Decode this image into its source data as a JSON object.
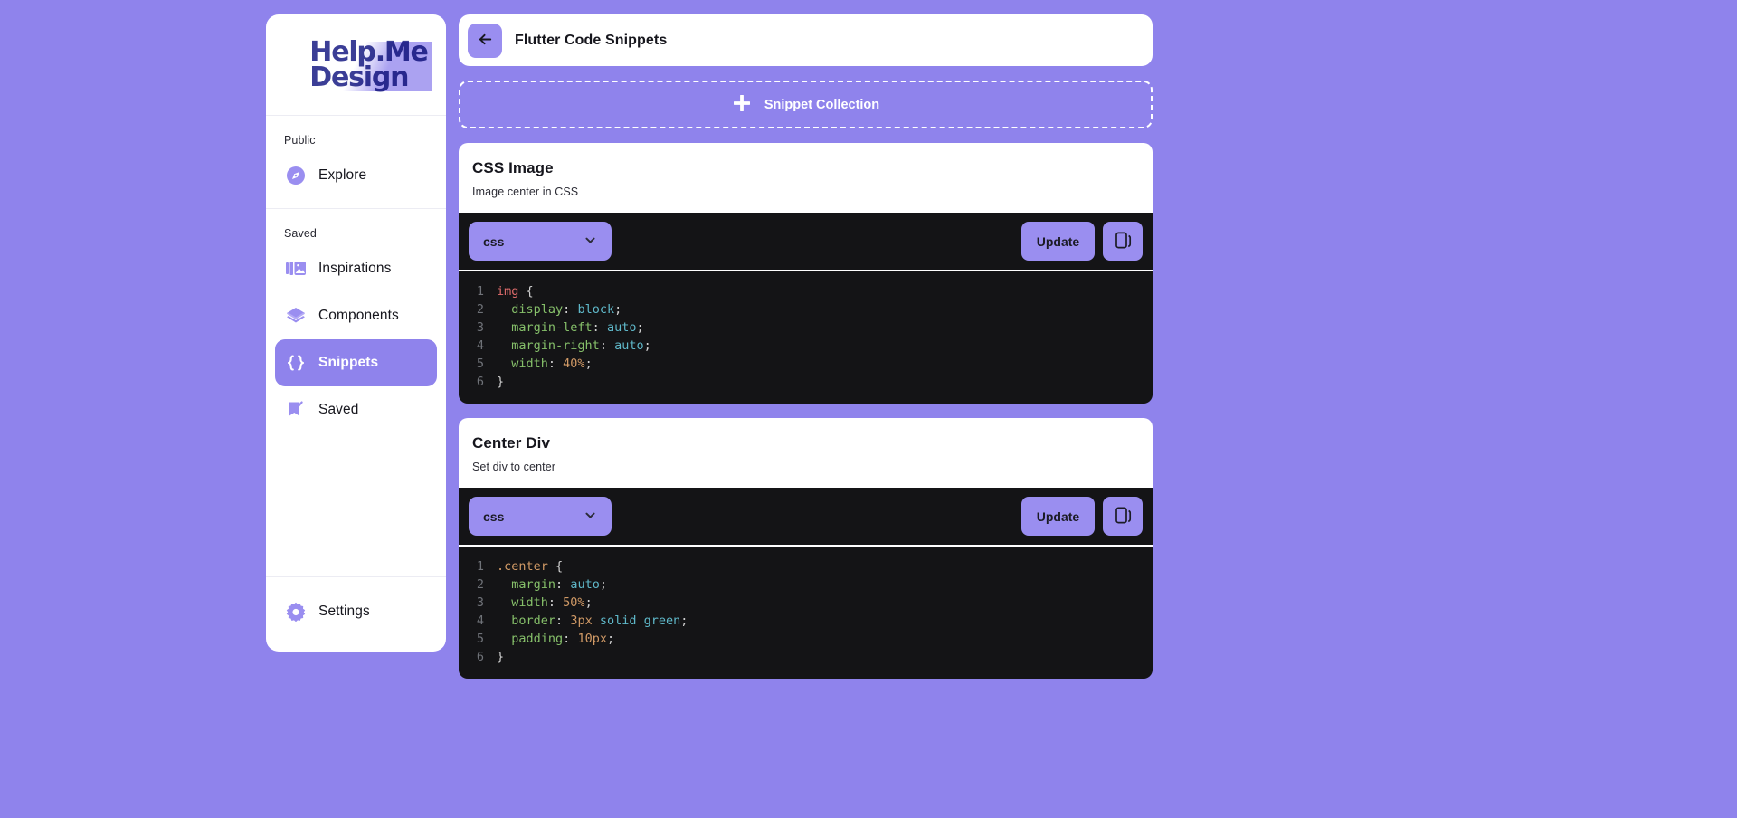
{
  "theme": {
    "background": "#8f83ec",
    "accent": "#9a8ef0",
    "card": "#ffffff",
    "code_bg": "#141416"
  },
  "sidebar": {
    "logo": {
      "line1": "Help.Me",
      "line2": "Design"
    },
    "sections": [
      {
        "label": "Public",
        "items": [
          {
            "label": "Explore",
            "icon": "compass-icon",
            "active": false
          }
        ]
      },
      {
        "label": "Saved",
        "items": [
          {
            "label": "Inspirations",
            "icon": "gallery-icon",
            "active": false
          },
          {
            "label": "Components",
            "icon": "layers-icon",
            "active": false
          },
          {
            "label": "Snippets",
            "icon": "braces-icon",
            "active": true
          },
          {
            "label": "Saved",
            "icon": "bookmark-check-icon",
            "active": false
          }
        ]
      }
    ],
    "settings": {
      "label": "Settings",
      "icon": "gear-icon"
    }
  },
  "topbar": {
    "back_icon": "arrow-left-icon",
    "title": "Flutter Code Snippets"
  },
  "collection_button": {
    "icon": "plus-icon",
    "label": "Snippet Collection"
  },
  "snippets": [
    {
      "title": "CSS Image",
      "description": "Image center in CSS",
      "language": "css",
      "dropdown_icon": "chevron-down-icon",
      "update_label": "Update",
      "copy_icon": "copy-icon",
      "code_lines": [
        {
          "n": "1",
          "tokens": [
            {
              "t": "img",
              "c": "tok-sel"
            },
            {
              "t": " {",
              "c": "tok-punc"
            }
          ]
        },
        {
          "n": "2",
          "tokens": [
            {
              "t": "  ",
              "c": "code-text"
            },
            {
              "t": "display",
              "c": "tok-prop"
            },
            {
              "t": ": ",
              "c": "tok-punc"
            },
            {
              "t": "block",
              "c": "tok-val"
            },
            {
              "t": ";",
              "c": "tok-punc"
            }
          ]
        },
        {
          "n": "3",
          "tokens": [
            {
              "t": "  ",
              "c": "code-text"
            },
            {
              "t": "margin-left",
              "c": "tok-prop"
            },
            {
              "t": ": ",
              "c": "tok-punc"
            },
            {
              "t": "auto",
              "c": "tok-val"
            },
            {
              "t": ";",
              "c": "tok-punc"
            }
          ]
        },
        {
          "n": "4",
          "tokens": [
            {
              "t": "  ",
              "c": "code-text"
            },
            {
              "t": "margin-right",
              "c": "tok-prop"
            },
            {
              "t": ": ",
              "c": "tok-punc"
            },
            {
              "t": "auto",
              "c": "tok-val"
            },
            {
              "t": ";",
              "c": "tok-punc"
            }
          ]
        },
        {
          "n": "5",
          "tokens": [
            {
              "t": "  ",
              "c": "code-text"
            },
            {
              "t": "width",
              "c": "tok-prop"
            },
            {
              "t": ": ",
              "c": "tok-punc"
            },
            {
              "t": "40%",
              "c": "tok-num"
            },
            {
              "t": ";",
              "c": "tok-punc"
            }
          ]
        },
        {
          "n": "6",
          "tokens": [
            {
              "t": "}",
              "c": "tok-punc"
            }
          ]
        }
      ]
    },
    {
      "title": "Center Div",
      "description": "Set div to center",
      "language": "css",
      "dropdown_icon": "chevron-down-icon",
      "update_label": "Update",
      "copy_icon": "copy-icon",
      "code_lines": [
        {
          "n": "1",
          "tokens": [
            {
              "t": ".center",
              "c": "tok-cls"
            },
            {
              "t": " {",
              "c": "tok-punc"
            }
          ]
        },
        {
          "n": "2",
          "tokens": [
            {
              "t": "  ",
              "c": "code-text"
            },
            {
              "t": "margin",
              "c": "tok-prop"
            },
            {
              "t": ": ",
              "c": "tok-punc"
            },
            {
              "t": "auto",
              "c": "tok-val"
            },
            {
              "t": ";",
              "c": "tok-punc"
            }
          ]
        },
        {
          "n": "3",
          "tokens": [
            {
              "t": "  ",
              "c": "code-text"
            },
            {
              "t": "width",
              "c": "tok-prop"
            },
            {
              "t": ": ",
              "c": "tok-punc"
            },
            {
              "t": "50%",
              "c": "tok-num"
            },
            {
              "t": ";",
              "c": "tok-punc"
            }
          ]
        },
        {
          "n": "4",
          "tokens": [
            {
              "t": "  ",
              "c": "code-text"
            },
            {
              "t": "border",
              "c": "tok-prop"
            },
            {
              "t": ": ",
              "c": "tok-punc"
            },
            {
              "t": "3px",
              "c": "tok-num"
            },
            {
              "t": " solid green",
              "c": "tok-val"
            },
            {
              "t": ";",
              "c": "tok-punc"
            }
          ]
        },
        {
          "n": "5",
          "tokens": [
            {
              "t": "  ",
              "c": "code-text"
            },
            {
              "t": "padding",
              "c": "tok-prop"
            },
            {
              "t": ": ",
              "c": "tok-punc"
            },
            {
              "t": "10px",
              "c": "tok-num"
            },
            {
              "t": ";",
              "c": "tok-punc"
            }
          ]
        },
        {
          "n": "6",
          "tokens": [
            {
              "t": "}",
              "c": "tok-punc"
            }
          ]
        }
      ]
    }
  ]
}
